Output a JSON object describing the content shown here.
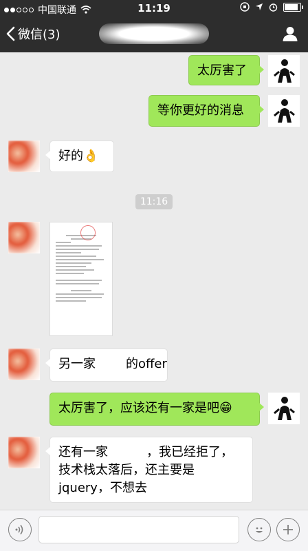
{
  "status_bar": {
    "carrier": "中国联通",
    "time": "11:19"
  },
  "nav": {
    "back_label": "微信(3)"
  },
  "messages": [
    {
      "side": "me",
      "text": "太厉害了"
    },
    {
      "side": "me",
      "text": "等你更好的消息"
    },
    {
      "side": "other",
      "text": "好的",
      "emoji": "👌"
    },
    {
      "side": "system",
      "text": "11:16"
    },
    {
      "side": "other",
      "type": "image",
      "content": "document-photo"
    },
    {
      "side": "other",
      "text_before": "另一家",
      "text_after": "的offer"
    },
    {
      "side": "me",
      "text": "太厉害了，应该还有一家是吧",
      "emoji": "😁"
    },
    {
      "side": "other",
      "line1_before": "还有一家",
      "line1_after": "，我已经拒了，",
      "line2": "技术栈太落后，还主要是",
      "line3": "jquery，不想去"
    }
  ],
  "colors": {
    "bar_bg": "#2d2d2d",
    "chat_bg": "#ebebeb",
    "my_bubble": "#a0e75a",
    "their_bubble": "#ffffff"
  },
  "icons": {
    "back": "chevron-left-icon",
    "profile": "person-icon",
    "voice": "voice-icon",
    "emoji": "smiley-icon",
    "plus": "plus-icon"
  }
}
